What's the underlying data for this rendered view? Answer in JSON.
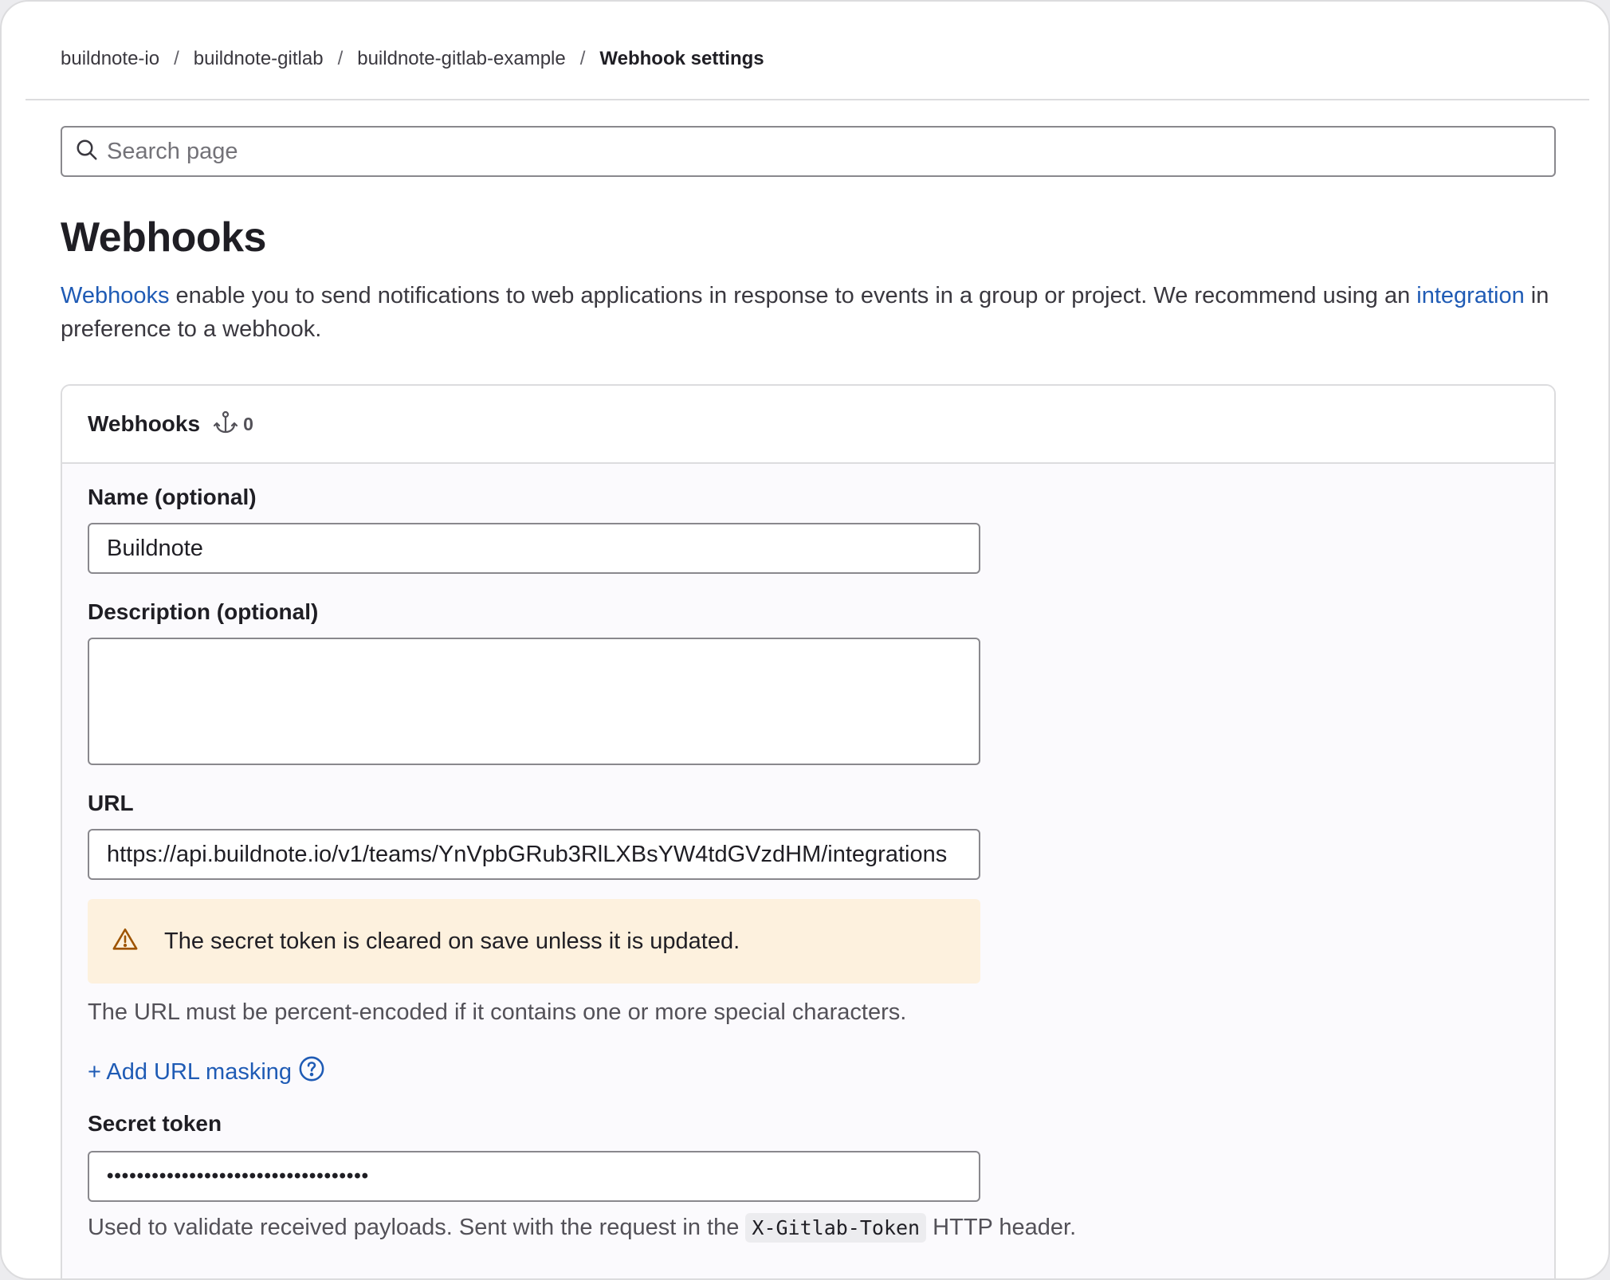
{
  "breadcrumb": {
    "items": [
      "buildnote-io",
      "buildnote-gitlab",
      "buildnote-gitlab-example"
    ],
    "current": "Webhook settings",
    "separator": "/"
  },
  "search": {
    "placeholder": "Search page"
  },
  "page": {
    "title": "Webhooks",
    "intro_link_1": "Webhooks",
    "intro_text_1": " enable you to send notifications to web applications in response to events in a group or project. We recommend using an ",
    "intro_link_2": "integration",
    "intro_text_2": " in preference to a webhook."
  },
  "card": {
    "title": "Webhooks",
    "count_icon": "anchor-icon",
    "count": "0"
  },
  "form": {
    "name_label": "Name (optional)",
    "name_value": "Buildnote",
    "description_label": "Description (optional)",
    "description_value": "",
    "url_label": "URL",
    "url_value": "https://api.buildnote.io/v1/teams/YnVpbGRub3RlLXBsYW4tdGVzdHM/integrations",
    "alert_icon": "warning-icon",
    "alert_text": "The secret token is cleared on save unless it is updated.",
    "url_help": "The URL must be percent-encoded if it contains one or more special characters.",
    "add_masking": "+ Add URL masking",
    "secret_label": "Secret token",
    "secret_value": "•••••••••••••••••••••••••••••••••••",
    "secret_help_1": "Used to validate received payloads. Sent with the request in the ",
    "secret_help_code": "X-Gitlab-Token",
    "secret_help_2": " HTTP header."
  },
  "colors": {
    "link": "#1f5bb5",
    "alert_bg": "#fdf1de",
    "alert_icon": "#9e5400",
    "card_bg": "#fbfafd",
    "border": "#dcdcde"
  }
}
